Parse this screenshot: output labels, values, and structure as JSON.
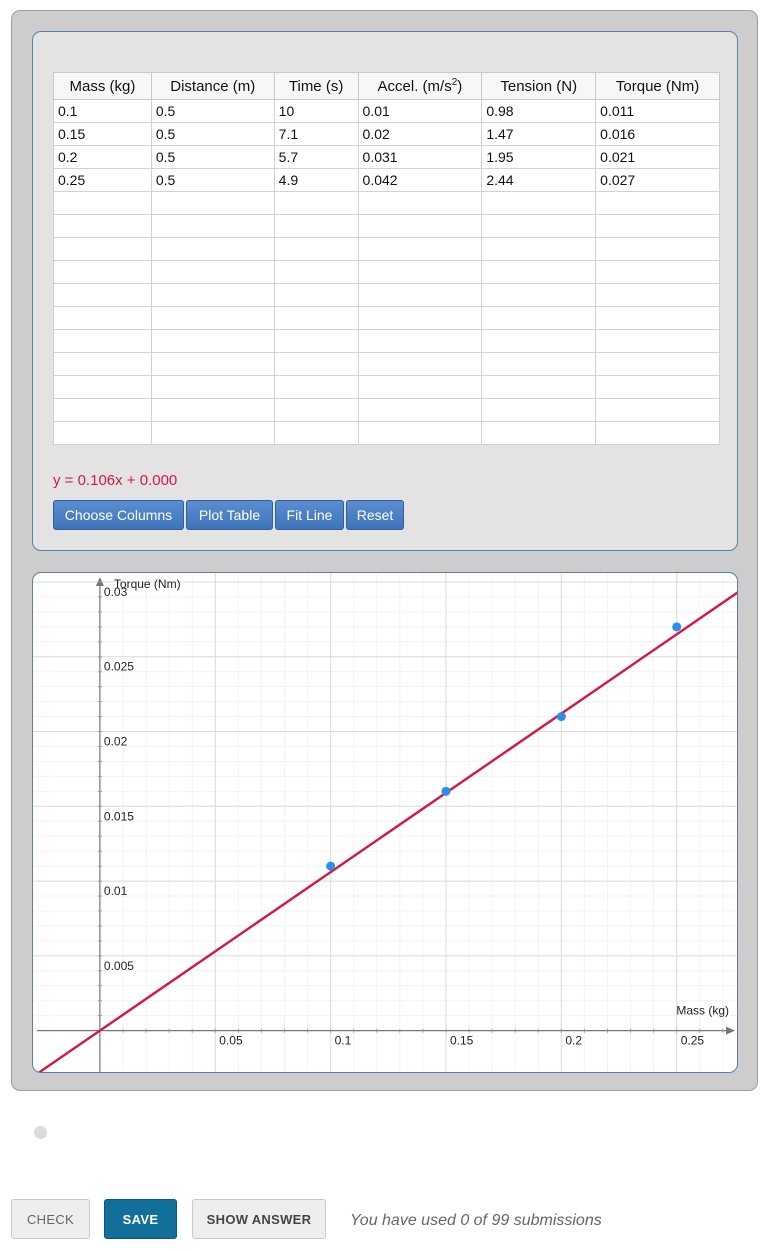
{
  "table": {
    "headers": [
      "Mass (kg)",
      "Distance (m)",
      "Time (s)",
      "Accel. (m/s",
      "Tension (N)",
      "Torque (Nm)"
    ],
    "accel_superscript": "2",
    "accel_close": ")",
    "rows": [
      [
        "0.1",
        "0.5",
        "10",
        "0.01",
        "0.98",
        "0.011"
      ],
      [
        "0.15",
        "0.5",
        "7.1",
        "0.02",
        "1.47",
        "0.016"
      ],
      [
        "0.2",
        "0.5",
        "5.7",
        "0.031",
        "1.95",
        "0.021"
      ],
      [
        "0.25",
        "0.5",
        "4.9",
        "0.042",
        "2.44",
        "0.027"
      ]
    ],
    "empty_rows": 11
  },
  "fit_equation": "y = 0.106x + 0.000",
  "buttons": {
    "choose_columns": "Choose Columns",
    "plot_table": "Plot Table",
    "fit_line": "Fit Line",
    "reset": "Reset"
  },
  "colors": {
    "accent": "#3f74b9",
    "fit_line": "#d8173e",
    "points": "#2e8de8"
  },
  "chart_data": {
    "type": "scatter",
    "xlabel": "Mass (kg)",
    "ylabel": "Torque (Nm)",
    "x_ticks": [
      "0.05",
      "0.1",
      "0.15",
      "0.2",
      "0.25"
    ],
    "y_ticks": [
      "0.005",
      "0.01",
      "0.015",
      "0.02",
      "0.025",
      "0.03"
    ],
    "xlim": [
      -0.029,
      0.277
    ],
    "ylim": [
      -0.0029,
      0.0306
    ],
    "grid": true,
    "points": [
      {
        "x": 0.1,
        "y": 0.011
      },
      {
        "x": 0.15,
        "y": 0.016
      },
      {
        "x": 0.2,
        "y": 0.021
      },
      {
        "x": 0.25,
        "y": 0.027
      }
    ],
    "fit": {
      "slope": 0.106,
      "intercept": 0.0
    }
  },
  "actions": {
    "check": "CHECK",
    "save": "SAVE",
    "show_answer": "SHOW ANSWER",
    "submissions": "You have used 0 of 99 submissions"
  }
}
